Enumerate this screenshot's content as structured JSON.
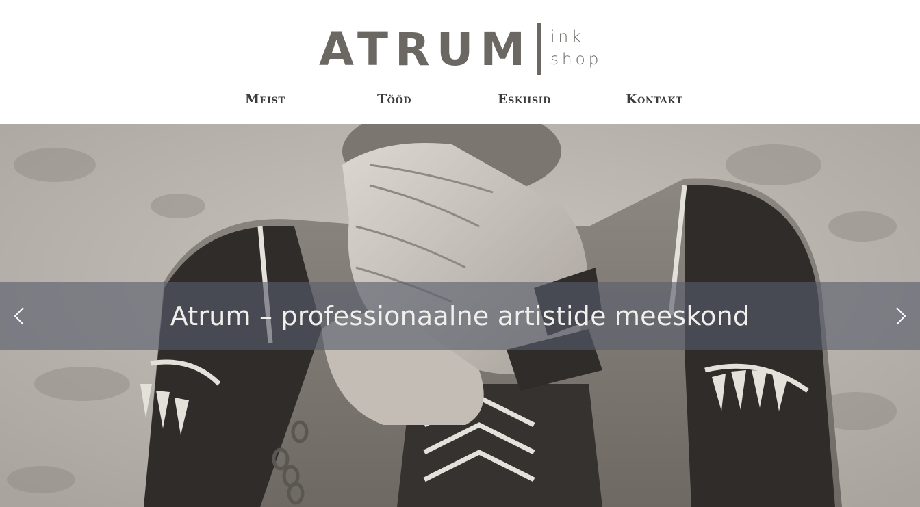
{
  "logo": {
    "main": "ATRUM",
    "sub_line1": "ink",
    "sub_line2": "shop"
  },
  "nav": {
    "items": [
      {
        "label": "Meist"
      },
      {
        "label": "Tööd"
      },
      {
        "label": "Eskiisid"
      },
      {
        "label": "Kontakt"
      }
    ]
  },
  "hero": {
    "caption": "Atrum – professionaalne artistide meeskond",
    "prev_icon": "chevron-left-icon",
    "next_icon": "chevron-right-icon"
  },
  "colors": {
    "logo": "#6b6762",
    "nav_text": "#3c3c3c",
    "caption_band": "#585e6c",
    "caption_text": "#f1efec"
  }
}
